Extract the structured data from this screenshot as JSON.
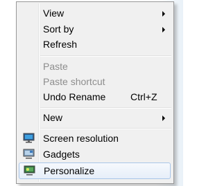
{
  "menu": {
    "view": {
      "label": "View",
      "icon": "submenu-arrow-icon"
    },
    "sort_by": {
      "label": "Sort by",
      "icon": "submenu-arrow-icon"
    },
    "refresh": {
      "label": "Refresh"
    },
    "paste": {
      "label": "Paste",
      "disabled": true
    },
    "paste_shortcut": {
      "label": "Paste shortcut",
      "disabled": true
    },
    "undo_rename": {
      "label": "Undo Rename",
      "shortcut": "Ctrl+Z"
    },
    "new": {
      "label": "New",
      "icon": "submenu-arrow-icon"
    },
    "screen_resolution": {
      "label": "Screen resolution",
      "icon": "monitor-icon"
    },
    "gadgets": {
      "label": "Gadgets",
      "icon": "gadgets-icon"
    },
    "personalize": {
      "label": "Personalize",
      "icon": "personalize-icon",
      "highlighted": true
    }
  },
  "colors": {
    "menu_bg": "#f0f0f0",
    "highlight_border": "#a8c5e8",
    "disabled_text": "#8d8d8d"
  }
}
